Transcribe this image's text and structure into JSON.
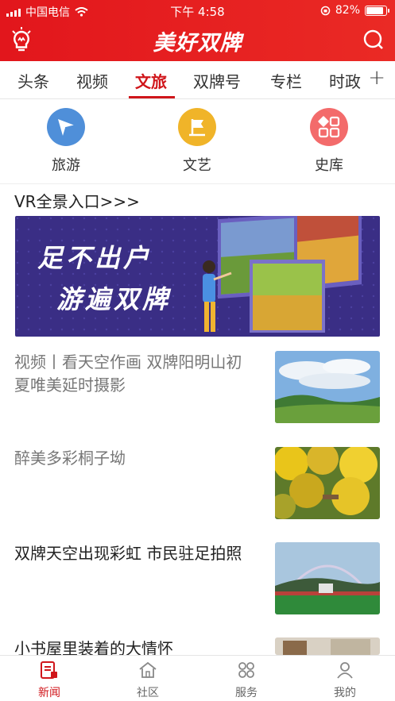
{
  "status": {
    "carrier": "中国电信",
    "time": "下午 4:58",
    "battery": "82%"
  },
  "header": {
    "title": "美好双牌"
  },
  "tabs": [
    "头条",
    "视频",
    "文旅",
    "双牌号",
    "专栏",
    "时政"
  ],
  "active_tab": "文旅",
  "categories": [
    {
      "label": "旅游",
      "icon": "send-icon",
      "color": "#4f8fd9"
    },
    {
      "label": "文艺",
      "icon": "flag-icon",
      "color": "#f0b429"
    },
    {
      "label": "史库",
      "icon": "grid-icon",
      "color": "#f36b6b"
    }
  ],
  "vr": {
    "title": "VR全景入口>>>"
  },
  "banner": {
    "line1": "足不出户",
    "line2": "游遍双牌"
  },
  "news": [
    {
      "title": "视频丨看天空作画 双牌阳明山初夏唯美延时摄影",
      "read": true
    },
    {
      "title": "醉美多彩桐子坳",
      "read": true
    },
    {
      "title": "双牌天空出现彩虹 市民驻足拍照",
      "read": false
    },
    {
      "title": "小书屋里装着的大情怀",
      "read": false
    }
  ],
  "bottom_nav": [
    {
      "label": "新闻",
      "icon": "news-icon",
      "active": true
    },
    {
      "label": "社区",
      "icon": "home-icon",
      "active": false
    },
    {
      "label": "服务",
      "icon": "services-icon",
      "active": false
    },
    {
      "label": "我的",
      "icon": "profile-icon",
      "active": false
    }
  ],
  "colors": {
    "brand": "#e2161c",
    "accent": "#d0161b"
  }
}
